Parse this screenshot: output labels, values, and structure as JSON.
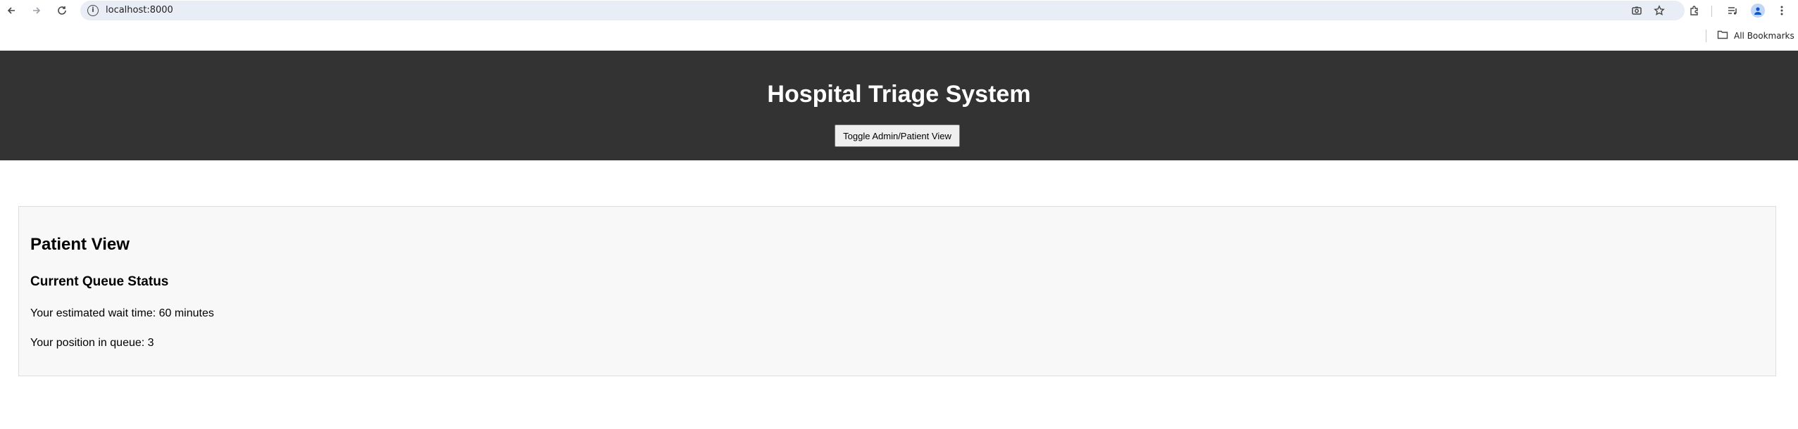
{
  "browser": {
    "url": "localhost:8000",
    "bookmarks_label": "All Bookmarks",
    "icons": [
      "back-arrow-icon",
      "forward-arrow-icon",
      "reload-icon",
      "site-info-icon",
      "screenshot-icon",
      "star-icon",
      "extensions-icon",
      "media-queue-icon",
      "profile-icon",
      "kebab-menu-icon",
      "folder-icon"
    ]
  },
  "header": {
    "title": "Hospital Triage System",
    "toggle_label": "Toggle Admin/Patient View",
    "background": "#333333"
  },
  "patient_view": {
    "title": "Patient View",
    "subtitle": "Current Queue Status",
    "wait_time_text": "Your estimated wait time: 60 minutes",
    "position_text": "Your position in queue: 3"
  }
}
